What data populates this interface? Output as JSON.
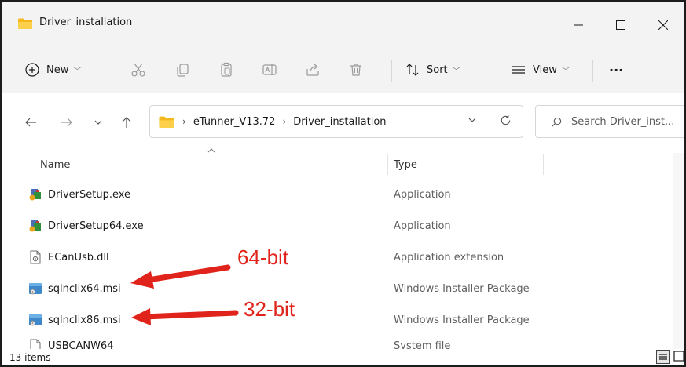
{
  "window": {
    "title": "Driver_installation"
  },
  "toolbar": {
    "new_label": "New",
    "sort_label": "Sort",
    "view_label": "View",
    "more_label": "···"
  },
  "address": {
    "crumbs": [
      "eTunner_V13.72",
      "Driver_installation"
    ]
  },
  "search": {
    "placeholder": "Search Driver_inst..."
  },
  "columns": {
    "name": "Name",
    "type": "Type"
  },
  "files": [
    {
      "name": "DriverSetup.exe",
      "type": "Application",
      "icon": "exe-setup-icon"
    },
    {
      "name": "DriverSetup64.exe",
      "type": "Application",
      "icon": "exe-setup-icon"
    },
    {
      "name": "ECanUsb.dll",
      "type": "Application extension",
      "icon": "dll-file-icon"
    },
    {
      "name": "sqlnclix64.msi",
      "type": "Windows Installer Package",
      "icon": "msi-installer-icon"
    },
    {
      "name": "sqlnclix86.msi",
      "type": "Windows Installer Package",
      "icon": "msi-installer-icon"
    },
    {
      "name": "USBCANW64",
      "type": "System file",
      "icon": "system-file-icon"
    }
  ],
  "annotations": {
    "label_64": "64-bit",
    "label_32": "32-bit",
    "color": "#e0241b"
  },
  "status": {
    "item_count": "13 items"
  },
  "colors": {
    "folder": "#f4b81c",
    "chrome": "#f3f3f3"
  }
}
